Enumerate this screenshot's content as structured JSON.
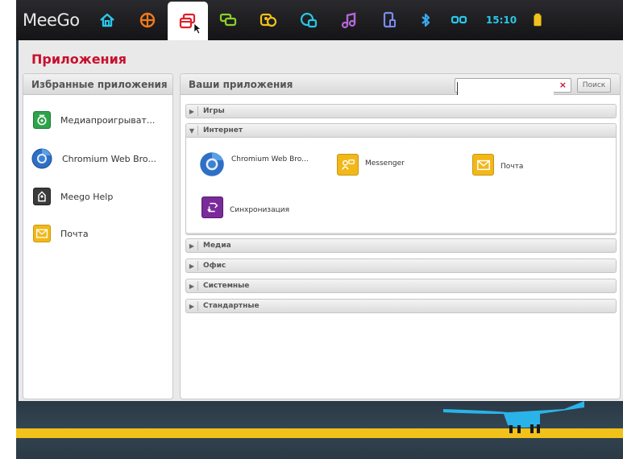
{
  "topbar": {
    "logo": "MeeGo",
    "clock": "15:10",
    "tabs": [
      {
        "name": "home",
        "icon": "home-icon",
        "color": "#29c7e8"
      },
      {
        "name": "web",
        "icon": "globe-icon",
        "color": "#f07a1a"
      },
      {
        "name": "applications",
        "icon": "applications-icon",
        "color": "#e0202a",
        "active": true
      },
      {
        "name": "messaging",
        "icon": "chat-icon",
        "color": "#8cd227"
      },
      {
        "name": "people",
        "icon": "people-icon",
        "color": "#f2c21a"
      },
      {
        "name": "status",
        "icon": "status-icon",
        "color": "#29c7e8"
      },
      {
        "name": "music",
        "icon": "music-icon",
        "color": "#b566d8"
      },
      {
        "name": "devices",
        "icon": "device-icon",
        "color": "#7a8cf0"
      }
    ],
    "status_colors": {
      "bluetooth": "#3aa8f0",
      "network": "#29c7e8",
      "battery": "#f2c21a"
    }
  },
  "page": {
    "title": "Приложения"
  },
  "favorites": {
    "header": "Избранные приложения",
    "items": [
      {
        "label": "Медиапроигрыват...",
        "icon": "media-player-icon"
      },
      {
        "label": "Chromium Web Bro...",
        "icon": "chromium-icon"
      },
      {
        "label": "Meego Help",
        "icon": "help-icon"
      },
      {
        "label": "Почта",
        "icon": "mail-icon"
      }
    ]
  },
  "apps": {
    "header": "Ваши приложения",
    "search_value": "",
    "search_clear": "×",
    "search_button": "Поиск",
    "categories": [
      {
        "label": "Игры",
        "expanded": false
      },
      {
        "label": "Интернет",
        "expanded": true
      },
      {
        "label": "Медиа",
        "expanded": false
      },
      {
        "label": "Офис",
        "expanded": false
      },
      {
        "label": "Системные",
        "expanded": false
      },
      {
        "label": "Стандартные",
        "expanded": false
      }
    ],
    "internet_apps": [
      {
        "label": "Chromium Web Bro...",
        "icon": "chromium-icon"
      },
      {
        "label": "Messenger",
        "icon": "messenger-icon"
      },
      {
        "label": "Почта",
        "icon": "mail-icon"
      },
      {
        "label": "Синхронизация",
        "icon": "sync-icon"
      }
    ]
  },
  "colors": {
    "title_red": "#c8102e",
    "wallpaper_yellow": "#f2c21a",
    "mascot_blue": "#2ab3e8"
  }
}
